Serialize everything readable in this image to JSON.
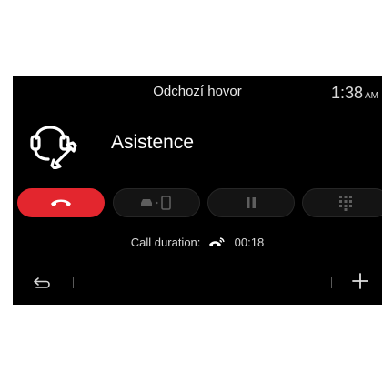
{
  "header": {
    "title": "Odchozí hovor",
    "time": "1:38",
    "ampm": "AM"
  },
  "contact": {
    "name": "Asistence",
    "icon": "headset-wrench-icon"
  },
  "controls": {
    "end_call": {
      "icon": "hang-up-icon",
      "color": "#e3262e"
    },
    "transfer": {
      "icon": "car-to-phone-icon"
    },
    "hold": {
      "icon": "pause-icon"
    },
    "keypad": {
      "icon": "keypad-icon"
    }
  },
  "call": {
    "duration_label": "Call duration:",
    "duration_value": "00:18",
    "icon": "phone-signal-icon"
  },
  "footer": {
    "back_icon": "back-arrow-icon",
    "add_icon": "plus-icon"
  }
}
